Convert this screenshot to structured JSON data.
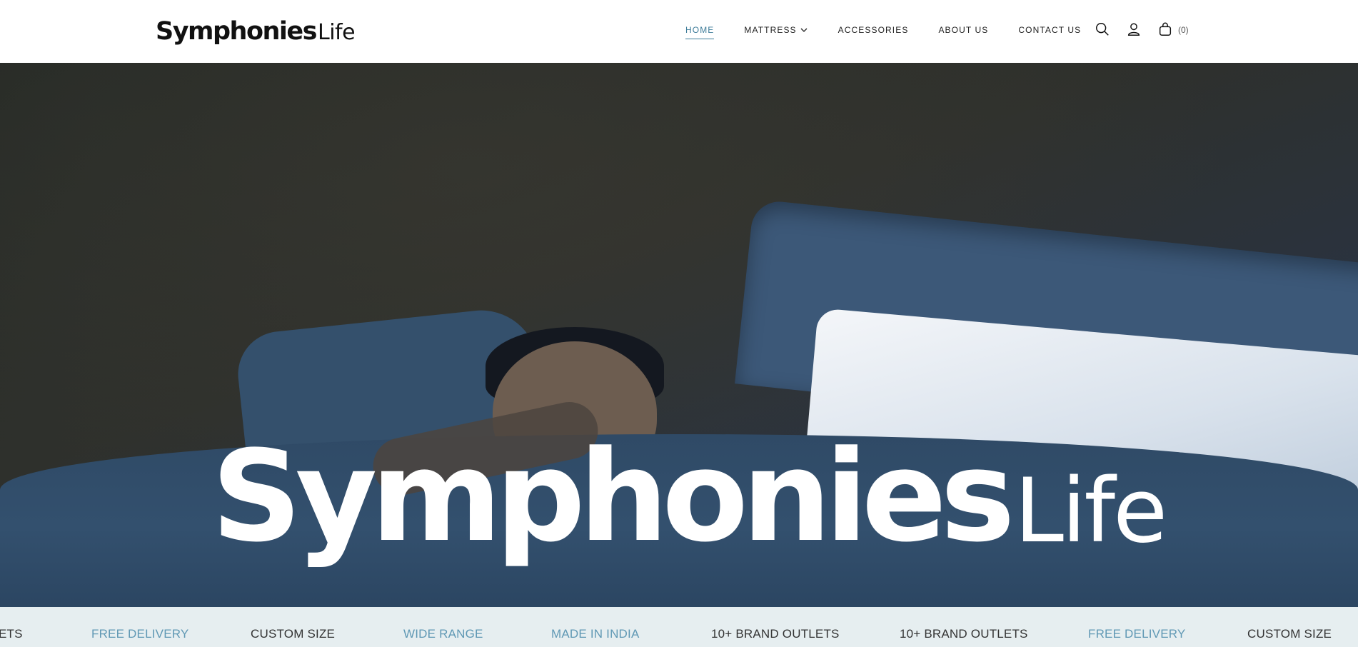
{
  "brand": {
    "name": "Symphonies",
    "suffix": "Life"
  },
  "nav": {
    "items": [
      {
        "label": "HOME",
        "active": true
      },
      {
        "label": "MATTRESS",
        "has_dropdown": true
      },
      {
        "label": "ACCESSORIES"
      },
      {
        "label": "ABOUT US"
      },
      {
        "label": "CONTACT US"
      }
    ]
  },
  "header_icons": {
    "search": "search-icon",
    "account": "user-icon",
    "cart": "shopping-bag-icon",
    "cart_count": "(0)"
  },
  "hero": {
    "logo_main": "Symphonies",
    "logo_life": "Life"
  },
  "marquee": {
    "items": [
      {
        "text": "ETS",
        "color": "#333333"
      },
      {
        "text": "FREE DELIVERY",
        "color": "#5f98b4"
      },
      {
        "text": "CUSTOM SIZE",
        "color": "#333333"
      },
      {
        "text": "WIDE RANGE",
        "color": "#5f98b4"
      },
      {
        "text": "MADE IN INDIA",
        "color": "#5f98b4"
      },
      {
        "text": "10+ BRAND OUTLETS",
        "color": "#333333"
      },
      {
        "text": "10+ BRAND OUTLETS",
        "color": "#333333"
      },
      {
        "text": "FREE DELIVERY",
        "color": "#5f98b4"
      },
      {
        "text": "CUSTOM SIZE",
        "color": "#333333"
      }
    ]
  },
  "colors": {
    "accent": "#3f7d9a",
    "marquee_bg": "#e6eef0"
  }
}
